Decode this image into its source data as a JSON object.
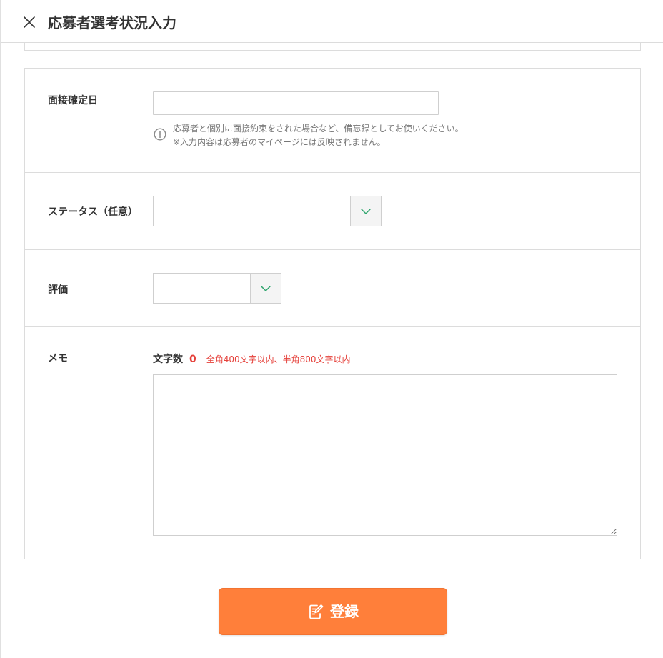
{
  "header": {
    "title": "応募者選考状況入力",
    "close_icon": "close-icon"
  },
  "form": {
    "interview_date": {
      "label": "面接確定日",
      "value": "",
      "help_icon": "info-icon",
      "help_lines": [
        "応募者と個別に面接約束をされた場合など、備忘録としてお使いください。",
        "※入力内容は応募者のマイページには反映されません。"
      ]
    },
    "status": {
      "label": "ステータス（任意）",
      "selected": "",
      "arrow_icon": "chevron-down-icon"
    },
    "rating": {
      "label": "評価",
      "selected": "",
      "arrow_icon": "chevron-down-icon"
    },
    "memo": {
      "label": "メモ",
      "count_label": "文字数",
      "count": 0,
      "limit_note": "全角400文字以内、半角800文字以内",
      "value": ""
    }
  },
  "submit": {
    "label": "登録",
    "icon": "edit-icon"
  },
  "colors": {
    "accent": "#ff7f3a",
    "alert_text": "#e5403a",
    "chevron": "#2ea56d",
    "border": "#dcdcdc"
  }
}
